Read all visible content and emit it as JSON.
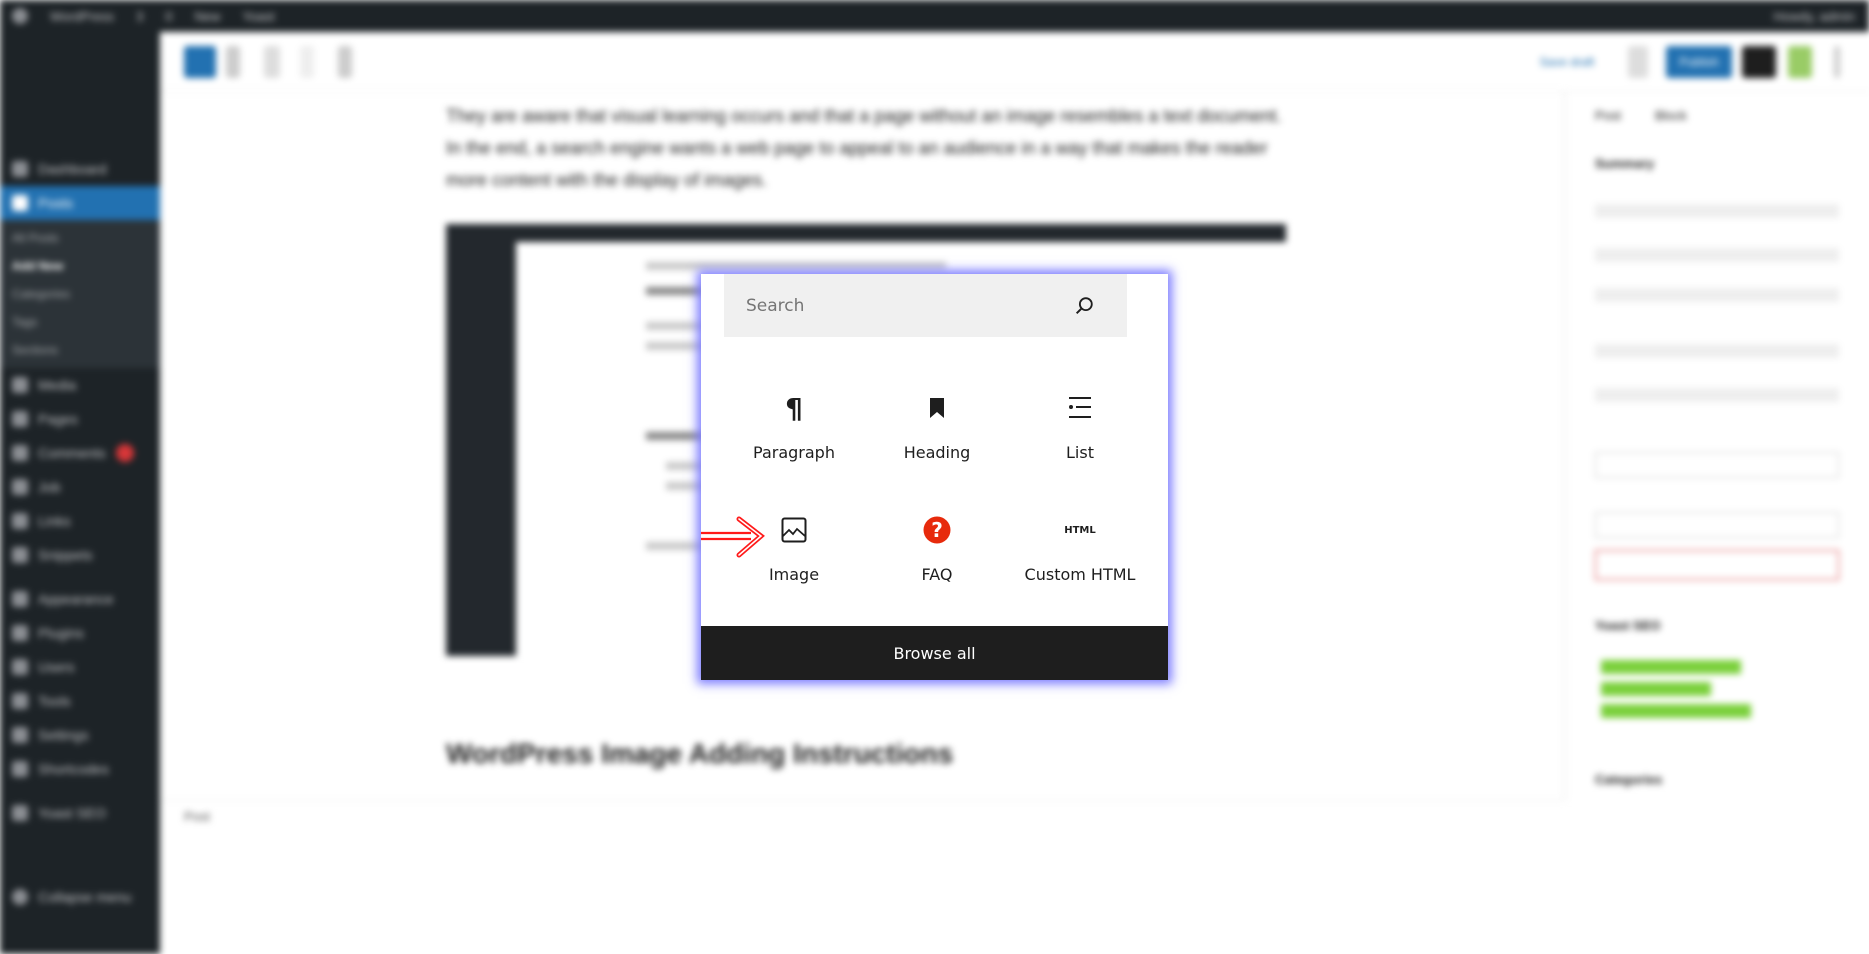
{
  "admin_bar": {
    "items": [
      "WordPress",
      "3",
      "0",
      "New",
      "Yoast"
    ],
    "account": "Howdy, admin"
  },
  "sidebar": {
    "items": [
      "Dashboard",
      "Posts",
      "Media",
      "Pages",
      "Comments",
      "Job",
      "Links",
      "Snippets",
      "Appearance",
      "Plugins",
      "Users",
      "Tools",
      "Settings",
      "Shortcodes",
      "Yoast SEO",
      "Collapse menu"
    ],
    "active": "Posts",
    "sub_items": [
      "All Posts",
      "Add New",
      "Categories",
      "Tags",
      "Sections"
    ]
  },
  "content": {
    "paragraph": "They are aware that visual learning occurs and that a page without an image resembles a text document. In the end, a search engine wants a web page to appeal to an audience in a way that makes the reader more content with the display of images.",
    "heading": "WordPress Image Adding Instructions",
    "breadcrumb": "Post"
  },
  "header": {
    "save_draft": "Save draft",
    "publish": "Publish"
  },
  "settings_panel": {
    "tabs": [
      "Post",
      "Block"
    ],
    "sections": [
      "Summary",
      "Yoast SEO",
      "Categories"
    ]
  },
  "inserter": {
    "search_placeholder": "Search",
    "blocks": [
      {
        "label": "Paragraph",
        "icon": "paragraph-icon"
      },
      {
        "label": "Heading",
        "icon": "bookmark-icon"
      },
      {
        "label": "List",
        "icon": "list-icon"
      },
      {
        "label": "Image",
        "icon": "image-icon"
      },
      {
        "label": "FAQ",
        "icon": "question-icon"
      },
      {
        "label": "Custom HTML",
        "icon": "html-icon",
        "icon_text": "HTML"
      }
    ],
    "browse_all": "Browse all"
  },
  "colors": {
    "accent": "#2271b1",
    "faq_red": "#e72a0c",
    "annotation_arrow": "#ff1a1a",
    "glow": "#7d7dff"
  }
}
